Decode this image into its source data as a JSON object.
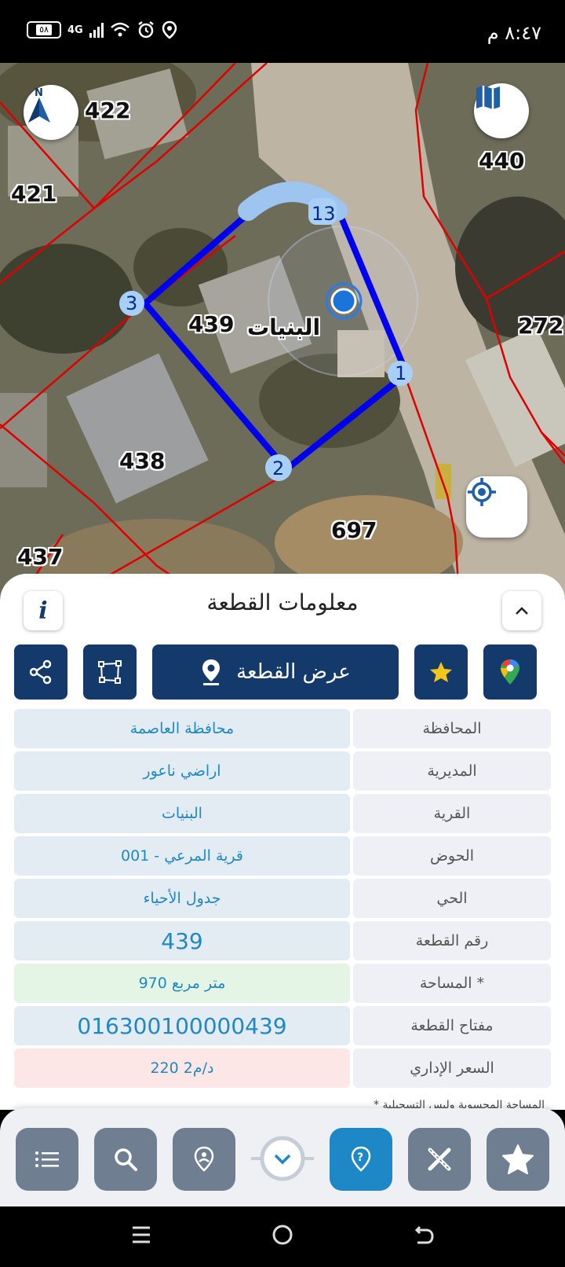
{
  "status_bar": {
    "time": "٨:٤٧ م",
    "battery": "٥٨",
    "network": "4G"
  },
  "map": {
    "parcel_labels": [
      "422",
      "421",
      "440",
      "272",
      "438",
      "439",
      "697",
      "437"
    ],
    "village_label": "البنيات",
    "vertex_labels": [
      "1",
      "2",
      "3",
      "13"
    ],
    "north_label": "N"
  },
  "sheet": {
    "title": "معلومات القطعة",
    "info_icon": "i",
    "show_parcel_label": "عرض القطعة",
    "rows": [
      {
        "label": "المحافظة",
        "value": "محافظة العاصمة"
      },
      {
        "label": "المديرية",
        "value": "اراضي ناعور"
      },
      {
        "label": "القرية",
        "value": "البنيات"
      },
      {
        "label": "الحوض",
        "value": "قرية المرعي - 001"
      },
      {
        "label": "الحي",
        "value": "جدول الأحياء"
      },
      {
        "label": "رقم القطعة",
        "value": "439"
      },
      {
        "label": "المساحة *",
        "value": "970  متر مربع"
      },
      {
        "label": "مفتاح القطعة",
        "value": "016300100000439"
      },
      {
        "label": "السعر الإداري",
        "value": "220 د/م2"
      }
    ],
    "note": "* المساحة المحسوبة وليس التسجيلية"
  },
  "colors": {
    "primary": "#143a6b",
    "accent": "#1e88c7",
    "value_text": "#1e89c4",
    "parcel_outline": "#0000ee",
    "boundary": "#e00000"
  },
  "icons": [
    "north-arrow-icon",
    "map-layers-icon",
    "locate-icon",
    "info-icon",
    "chevron-up-icon",
    "share-icon",
    "polygon-icon",
    "location-pin-icon",
    "star-icon",
    "google-maps-icon",
    "list-icon",
    "search-icon",
    "place-icon",
    "chevron-down-icon",
    "help-icon",
    "tools-icon",
    "favorite-icon"
  ]
}
